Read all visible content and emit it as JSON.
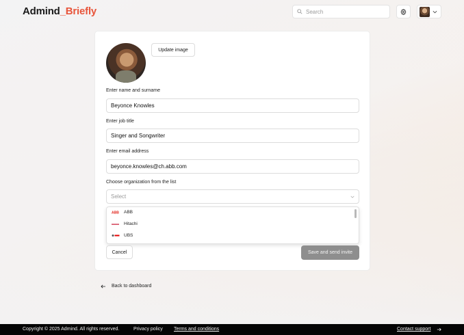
{
  "header": {
    "logo_main": "Admind",
    "logo_accent": "_Briefly",
    "search_placeholder": "Search",
    "gear_icon": "gear-icon",
    "user_menu_icon": "chevron-down-icon"
  },
  "form": {
    "update_image_label": "Update image",
    "name": {
      "label": "Enter name and surname",
      "value": "Beyonce Knowles"
    },
    "job": {
      "label": "Enter job title",
      "value": "Singer and Songwriter"
    },
    "email": {
      "label": "Enter email address",
      "value": "beyonce.knowles@ch.abb.com"
    },
    "org": {
      "label": "Choose organization from the list",
      "placeholder": "Select",
      "options": [
        {
          "label": "ABB",
          "logo_color": "#e2231a"
        },
        {
          "label": "Hitachi",
          "logo_color": "#c8102e"
        },
        {
          "label": "UBS",
          "logo_color": "#e60000"
        }
      ]
    },
    "cancel_label": "Cancel",
    "save_label": "Save and send invite"
  },
  "back_link": "Back to dashboard",
  "footer": {
    "copyright": "Copyright © 2025 Admind. All rights reserved.",
    "privacy": "Privacy policy",
    "terms": "Terms and conditions",
    "support": "Contact support"
  },
  "colors": {
    "accent": "#e8553b",
    "footer_bg": "#050505",
    "save_button_bg": "#8e8e8e"
  }
}
